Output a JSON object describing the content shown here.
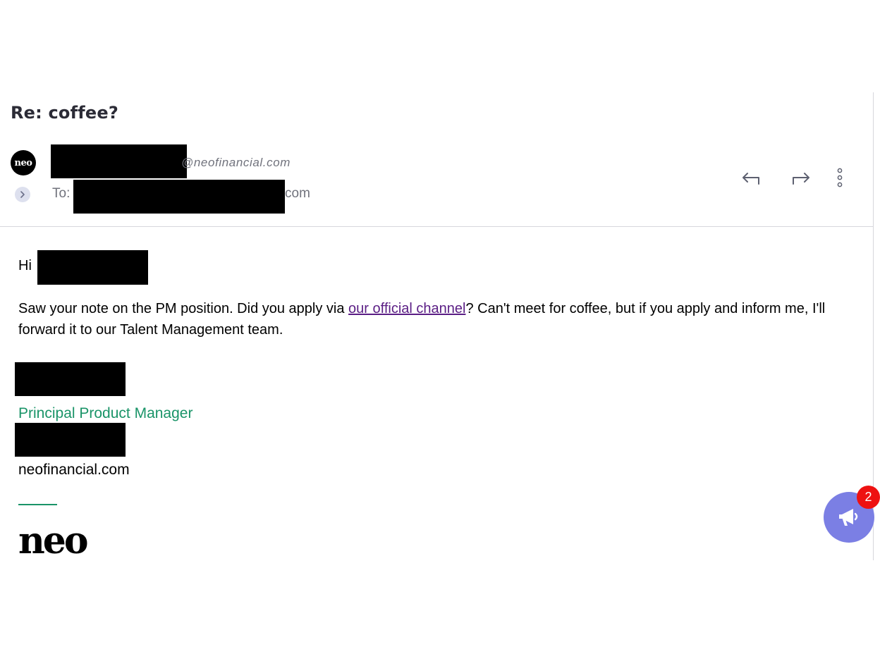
{
  "email": {
    "subject": "Re: coffee?",
    "sender": {
      "avatar_text": "neo",
      "email_domain": "@neofinancial.com"
    },
    "recipient": {
      "to_label": "To:",
      "email_suffix": "com"
    },
    "actions": [
      {
        "name": "reply",
        "icon": "reply-icon"
      },
      {
        "name": "forward",
        "icon": "forward-icon"
      },
      {
        "name": "more",
        "icon": "more-vertical-icon"
      }
    ],
    "body": {
      "greeting": "Hi",
      "text_before_link": "Saw your note on the PM position. Did you apply via ",
      "link_text": "our official channel",
      "text_after_link": "? Can't meet for coffee, but if you apply and inform me, I'll forward it to our Talent Management team."
    },
    "signature": {
      "title": "Principal Product Manager",
      "domain": "neofinancial.com",
      "logo_text": "neo"
    }
  },
  "notifications": {
    "icon": "megaphone-icon",
    "count": "2"
  },
  "colors": {
    "accent_green": "#1a9468",
    "link": "#5a1d84",
    "fab": "#7b7fe4",
    "badge": "#ee1111"
  }
}
